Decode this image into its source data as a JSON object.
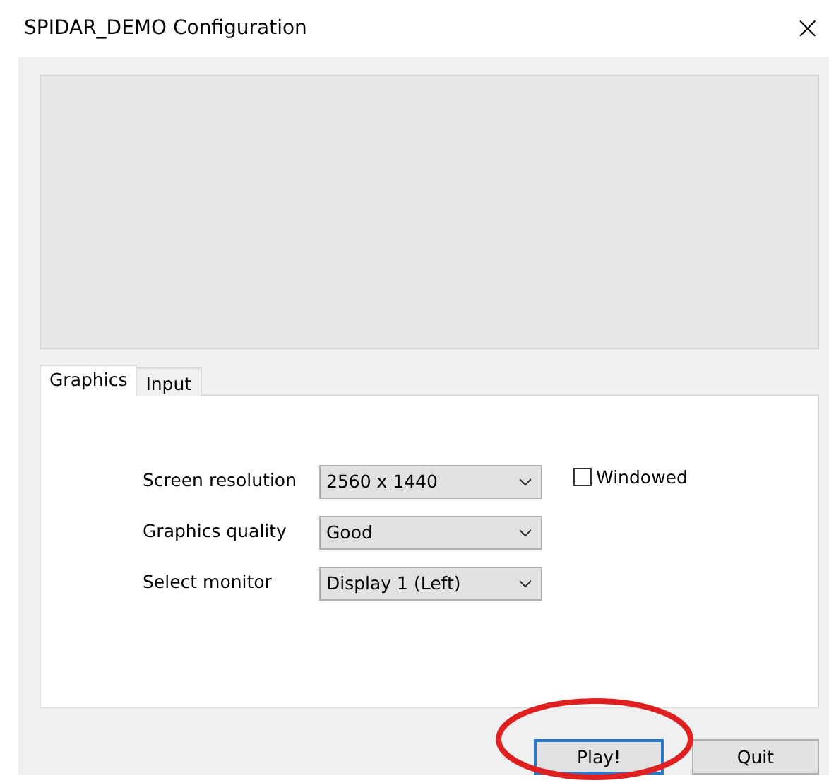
{
  "window": {
    "title": "SPIDAR_DEMO Configuration",
    "close": "×"
  },
  "tabs": [
    {
      "label": "Graphics",
      "selected": true
    },
    {
      "label": "Input",
      "selected": false
    }
  ],
  "settings": [
    {
      "label": "Screen resolution",
      "value": "2560 x 1440"
    },
    {
      "label": "Graphics quality",
      "value": "Good"
    },
    {
      "label": "Select monitor",
      "value": "Display 1 (Left)"
    }
  ],
  "windowed": {
    "label": "Windowed",
    "checked": false
  },
  "buttons": [
    {
      "label": "Play!",
      "default": true,
      "circled": true
    },
    {
      "label": "Quit",
      "default": false,
      "circled": false
    }
  ]
}
